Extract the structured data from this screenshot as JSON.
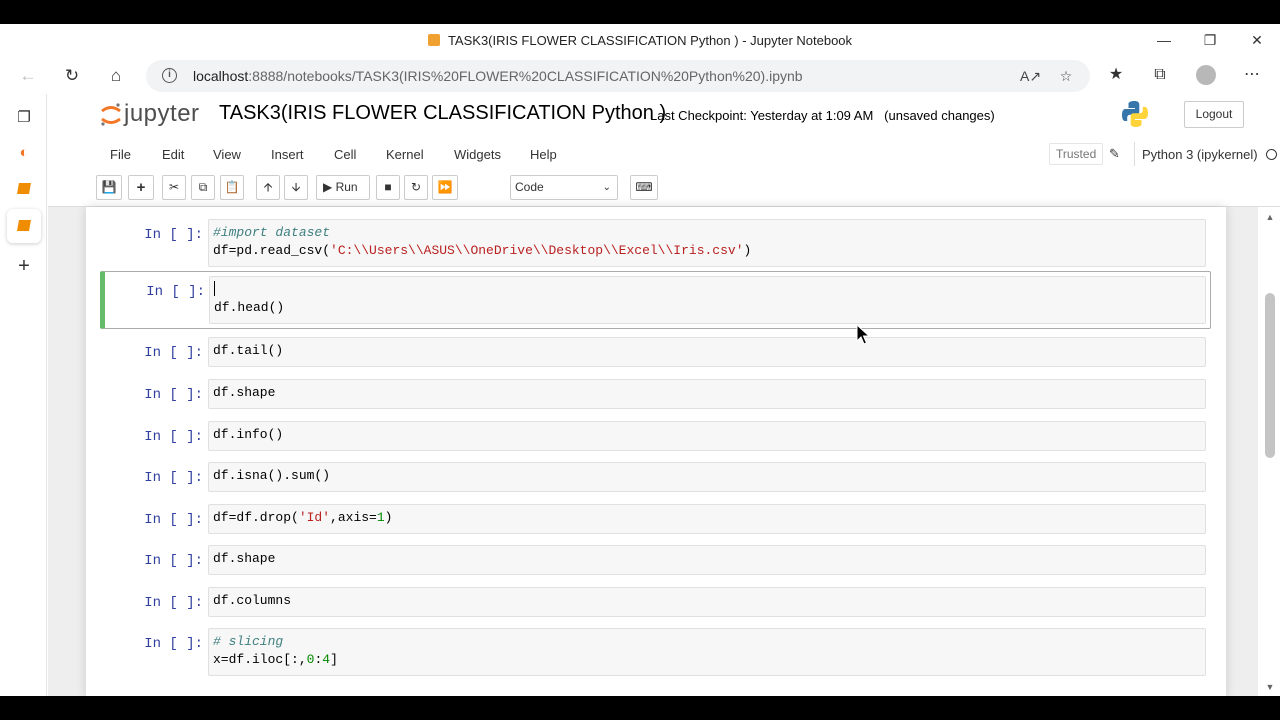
{
  "window": {
    "title": "TASK3(IRIS FLOWER CLASSIFICATION Python ) - Jupyter Notebook"
  },
  "browser": {
    "url_host": "localhost",
    "url_path": ":8888/notebooks/TASK3(IRIS%20FLOWER%20CLASSIFICATION%20Python%20).ipynb"
  },
  "jupyter": {
    "logo_text": "jupyter",
    "notebook_title": "TASK3(IRIS FLOWER CLASSIFICATION Python )",
    "checkpoint": "Last Checkpoint: Yesterday at 1:09 AM",
    "unsaved": "(unsaved changes)",
    "logout_label": "Logout",
    "menu": [
      "File",
      "Edit",
      "View",
      "Insert",
      "Cell",
      "Kernel",
      "Widgets",
      "Help"
    ],
    "trusted_label": "Trusted",
    "kernel_name": "Python 3 (ipykernel)",
    "run_label": "Run",
    "cell_type": "Code"
  },
  "cells": [
    {
      "prompt": "In [ ]:",
      "lines": [
        "#import dataset",
        "df=pd.read_csv('C:\\\\Users\\\\ASUS\\\\OneDrive\\\\Desktop\\\\Excel\\\\Iris.csv')"
      ]
    },
    {
      "prompt": "In [ ]:",
      "lines": [
        "",
        "df.head()"
      ]
    },
    {
      "prompt": "In [ ]:",
      "lines": [
        "df.tail()"
      ]
    },
    {
      "prompt": "In [ ]:",
      "lines": [
        "df.shape"
      ]
    },
    {
      "prompt": "In [ ]:",
      "lines": [
        "df.info()"
      ]
    },
    {
      "prompt": "In [ ]:",
      "lines": [
        "df.isna().sum()"
      ]
    },
    {
      "prompt": "In [ ]:",
      "lines": [
        "df=df.drop('Id',axis=1)"
      ]
    },
    {
      "prompt": "In [ ]:",
      "lines": [
        "df.shape"
      ]
    },
    {
      "prompt": "In [ ]:",
      "lines": [
        "df.columns"
      ]
    },
    {
      "prompt": "In [ ]:",
      "lines": [
        "# slicing",
        "x=df.iloc[:,0:4]"
      ]
    }
  ],
  "code_parts": {
    "c0_comment": "#import dataset",
    "c0_pre": "df=pd.read_csv(",
    "c0_str": "'C:\\\\Users\\\\ASUS\\\\OneDrive\\\\Desktop\\\\Excel\\\\Iris.csv'",
    "c0_post": ")",
    "c6_pre": "df=df.drop(",
    "c6_str": "'Id'",
    "c6_mid": ",axis=",
    "c6_num": "1",
    "c6_post": ")",
    "c9_comment": "# slicing",
    "c9_pre": "x=df.iloc[:,",
    "c9_n1": "0",
    "c9_mid": ":",
    "c9_n2": "4",
    "c9_post": "]"
  },
  "colors": {
    "selected_cell_border": "#66bb6a",
    "prompt": "#303f9f",
    "string": "#ba2121",
    "number": "#008800",
    "comment": "#408080",
    "jupyter_orange": "#f37726"
  }
}
